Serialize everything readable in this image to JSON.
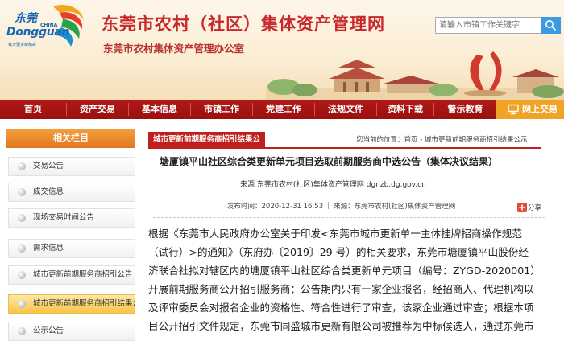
{
  "header": {
    "logo": {
      "cn": "东莞",
      "en": "Dongguan",
      "country": "CHINA",
      "slogan": "每天更多新精彩"
    },
    "title": "东莞市农村（社区）集体资产管理网",
    "subtitle": "东莞市农村集体资产管理办公室",
    "search_placeholder": "请输入市镇工作关键字",
    "colors": {
      "title": "#c8282b",
      "nav": "#a8161a",
      "accent": "#f0a324"
    }
  },
  "nav": {
    "items": [
      {
        "label": "首页"
      },
      {
        "label": "资产交易"
      },
      {
        "label": "基本信息"
      },
      {
        "label": "市镇工作"
      },
      {
        "label": "党建工作"
      },
      {
        "label": "法规文件"
      },
      {
        "label": "资料下载"
      },
      {
        "label": "警示教育"
      }
    ],
    "login": "网上交易"
  },
  "sidebar": {
    "heading": "相关栏目",
    "items": [
      {
        "label": "交易公告"
      },
      {
        "label": "成交信息"
      },
      {
        "label": "现场交易时间公告"
      },
      {
        "label": "需求信息"
      },
      {
        "label": "城市更新前期服务商招引公告"
      },
      {
        "label": "城市更新前期服务商招引结果公示"
      },
      {
        "label": "公示公告"
      }
    ],
    "active_index": 5
  },
  "main": {
    "tab": "城市更新前期服务商招引结果公",
    "breadcrumb": {
      "prefix": "您当前的位置：",
      "home": "首页",
      "sep": " - ",
      "current": "城市更新前期服务商招引结果公示"
    },
    "article": {
      "title": "塘厦镇平山社区综合类更新单元项目选取前期服务商中选公告（集体决议结果）",
      "source_url": "来源 东莞市农村(社区)集体资产管理网 dgnzb.dg.gov.cn",
      "date": "发布时间：2020-12-31 16:53",
      "source": "来源：东莞市农村(社区)集体资产管理网",
      "share": "分享",
      "body": [
        "根据《东莞市人民政府办公室关于印发<东莞市城市更新单一主体挂牌招商操作规范",
        "（试行）>的通知》（东府办〔2019〕29 号）的相关要求，东莞市塘厦镇平山股份经",
        "济联合社拟对辖区内的塘厦镇平山社区综合类更新单元项目（编号：ZYGD-2020001）",
        "开展前期服务商公开招引服务商：公告期内只有一家企业报名，经招商人、代理机构以",
        "及评审委员会对报名企业的资格性、符合性进行了审查，该家企业通过审查；根据本项",
        "目公开招引文件规定，东莞市同盛城市更新有限公司被推荐为中标候选人，通过东莞市"
      ]
    }
  }
}
